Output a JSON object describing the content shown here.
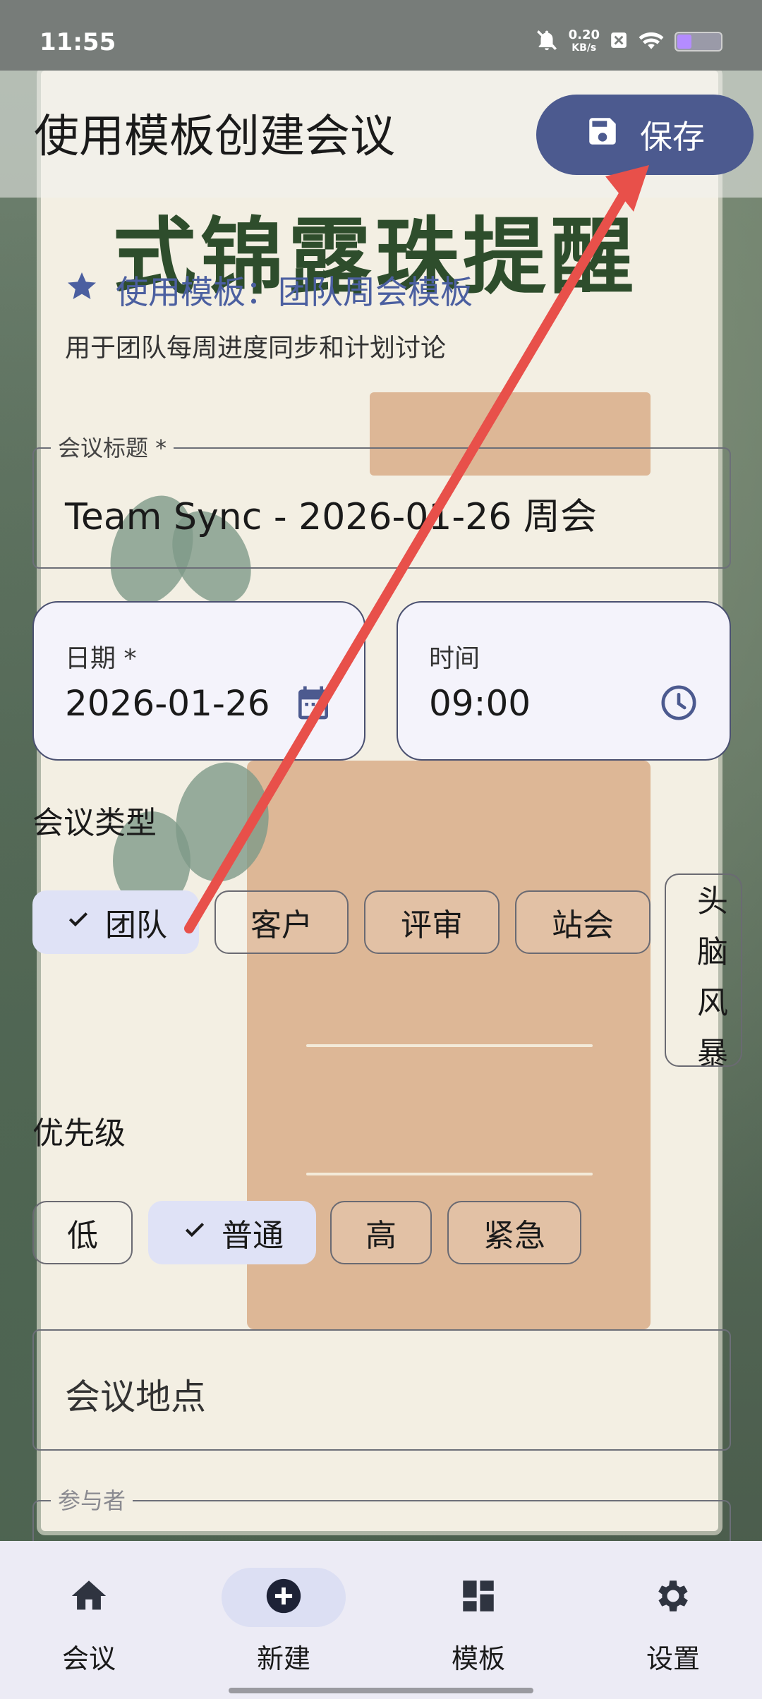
{
  "status_bar": {
    "time": "11:55",
    "net_speed_value": "0.20",
    "net_speed_unit": "KB/s"
  },
  "header": {
    "title": "使用模板创建会议",
    "save_label": "保存"
  },
  "banner": {
    "text": "式锦露珠提醒"
  },
  "template": {
    "title": "使用模板：团队周会模板",
    "description": "用于团队每周进度同步和计划讨论"
  },
  "form": {
    "meeting_title": {
      "label": "会议标题 *",
      "value": "Team Sync - 2026-01-26 周会"
    },
    "date": {
      "label": "日期 *",
      "value": "2026-01-26"
    },
    "time": {
      "label": "时间",
      "value": "09:00"
    },
    "meeting_type": {
      "label": "会议类型",
      "options": [
        "团队",
        "客户",
        "评审",
        "站会",
        "头脑风暴"
      ],
      "selected": "团队"
    },
    "priority": {
      "label": "优先级",
      "options": [
        "低",
        "普通",
        "高",
        "紧急"
      ],
      "selected": "普通"
    },
    "location": {
      "placeholder": "会议地点"
    },
    "participants": {
      "label": "参与者"
    }
  },
  "bottom_nav": {
    "items": [
      {
        "label": "会议",
        "icon": "home-icon"
      },
      {
        "label": "新建",
        "icon": "add-circle-icon",
        "active": true
      },
      {
        "label": "模板",
        "icon": "dashboard-icon"
      },
      {
        "label": "设置",
        "icon": "gear-icon"
      }
    ]
  },
  "colors": {
    "primary": "#4c5a8f",
    "chip_selected": "#dfe2f6",
    "annotation_arrow": "#e8504a"
  }
}
